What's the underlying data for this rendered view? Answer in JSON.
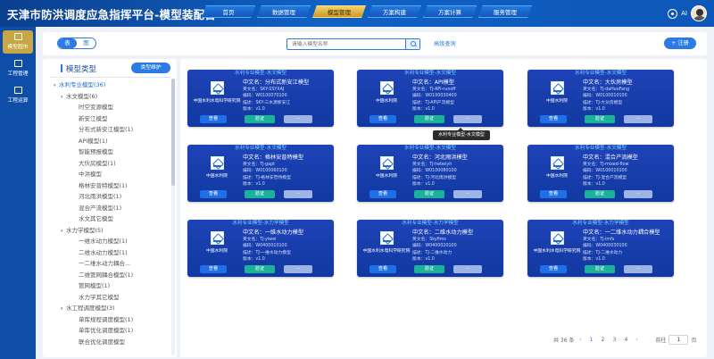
{
  "header": {
    "title": "天津市防洪调度应急指挥平台-模型装配台",
    "nav": [
      "首页",
      "数据管理",
      "模型管理",
      "方案构建",
      "方案计算",
      "服务管理"
    ],
    "active_nav": 2,
    "user_label": "AI"
  },
  "rail": {
    "items": [
      {
        "label": "模型超市",
        "icon": "model-market-icon",
        "active": true
      },
      {
        "label": "工程管理",
        "icon": "project-icon",
        "active": false
      },
      {
        "label": "工程运算",
        "icon": "compute-icon",
        "active": false
      }
    ]
  },
  "toolbar": {
    "toggle": [
      "表",
      "图"
    ],
    "search_placeholder": "请输入模型名称",
    "advanced": "高级查询",
    "register": "+ 注册"
  },
  "tree": {
    "title": "模型类型",
    "maint_button": "类型维护",
    "nodes": [
      {
        "label": "水利专业模型(36)",
        "level": 0,
        "caret": "▾"
      },
      {
        "label": "水文模型(6)",
        "level": 1,
        "caret": "▾"
      },
      {
        "label": "时空变源模型",
        "level": 2,
        "caret": ""
      },
      {
        "label": "新安江模型",
        "level": 2,
        "caret": ""
      },
      {
        "label": "分布式新安江模型(1)",
        "level": 2,
        "caret": ""
      },
      {
        "label": "API模型(1)",
        "level": 2,
        "caret": ""
      },
      {
        "label": "智能预报模型",
        "level": 2,
        "caret": ""
      },
      {
        "label": "大伙房模型(1)",
        "level": 2,
        "caret": ""
      },
      {
        "label": "中洪模型",
        "level": 2,
        "caret": ""
      },
      {
        "label": "格林安普特模型(1)",
        "level": 2,
        "caret": ""
      },
      {
        "label": "河北雨洪模型(1)",
        "level": 2,
        "caret": ""
      },
      {
        "label": "混合产流模型(1)",
        "level": 2,
        "caret": ""
      },
      {
        "label": "水文其它模型",
        "level": 2,
        "caret": ""
      },
      {
        "label": "水力学模型(5)",
        "level": 1,
        "caret": "▾"
      },
      {
        "label": "一维水动力模型(1)",
        "level": 2,
        "caret": ""
      },
      {
        "label": "二维水动力模型(1)",
        "level": 2,
        "caret": ""
      },
      {
        "label": "一二维水动力耦合...",
        "level": 2,
        "caret": ""
      },
      {
        "label": "二维管网耦合模型(1)",
        "level": 2,
        "caret": ""
      },
      {
        "label": "管网模型(1)",
        "level": 2,
        "caret": ""
      },
      {
        "label": "水力学其它模型",
        "level": 2,
        "caret": ""
      },
      {
        "label": "水工程调度模型(3)",
        "level": 1,
        "caret": "▾"
      },
      {
        "label": "单库规程调度模型(1)",
        "level": 2,
        "caret": ""
      },
      {
        "label": "单库优化调度模型(1)",
        "level": 2,
        "caret": ""
      },
      {
        "label": "联合优化调度模型",
        "level": 2,
        "caret": ""
      }
    ]
  },
  "cards": [
    {
      "category": "水利专业模型-水文模型",
      "org": "中国水利水电科学研究院",
      "cn": "中文名：分布式新安江模型",
      "en": "英文名：SKY-SSYXAJ",
      "code": "编码：W0100070100",
      "desc": "描述：SKY-三水源新安江",
      "ver": "版本：v1.0"
    },
    {
      "category": "水利专业模型-水文模型",
      "org": "中国水利院",
      "cn": "中文名：API模型",
      "en": "英文名：TJ-API-runoff",
      "code": "编码：W0100030400",
      "desc": "描述：TJ-API产流模型",
      "ver": "版本：v1.0"
    },
    {
      "category": "水利专业模型-水文模型",
      "org": "中国水利院",
      "cn": "中文名：大伙房模型",
      "en": "英文名：TJ-daHuoFang",
      "code": "编码：W0100010100",
      "desc": "描述：TJ-大伙房模型",
      "ver": "版本：v1.0"
    },
    {
      "category": "水利专业模型-水文模型",
      "org": "中国水利院",
      "cn": "中文名：格林安普特模型",
      "en": "英文名：TJ-gapt",
      "code": "编码：W0100060100",
      "desc": "描述：TJ-格林安普特模型",
      "ver": "版本：v1.0"
    },
    {
      "category": "水利专业模型-水文模型",
      "org": "中国水利院",
      "cn": "中文名：河北雨洪模型",
      "en": "英文名：TJ-hebeiyh",
      "code": "编码：W0100080100",
      "desc": "描述：TJ-河北雨洪模型",
      "ver": "版本：v1.0"
    },
    {
      "category": "水利专业模型-水文模型",
      "org": "中国水利院",
      "cn": "中文名：混合产流模型",
      "en": "英文名：TJ-mixed-flow",
      "code": "编码：W0100010100",
      "desc": "描述：TJ-混合产流模型",
      "ver": "版本：v1.0"
    },
    {
      "category": "水利专业模型-水力学模型",
      "org": "中国水利院",
      "cn": "中文名：一维水动力模型",
      "en": "英文名：TJ-yiwei",
      "code": "编码：W0400010100",
      "desc": "描述：TJ-一维水动力模型",
      "ver": "版本：v1.0"
    },
    {
      "category": "水利专业模型-水力学模型",
      "org": "中国水利水电科学研究院",
      "cn": "中文名：二维水动力模型",
      "en": "英文名：Skyfims",
      "code": "编码：W0400020100",
      "desc": "描述：TJ-二维水动力",
      "ver": "版本：v1.0"
    },
    {
      "category": "水利专业模型-水力学模型",
      "org": "中国水利水电科学研究院",
      "cn": "中文名：一二维水动力耦合模型",
      "en": "英文名：TJ-imfs",
      "code": "编码：W0400030100",
      "desc": "描述：TJ-二维水动力",
      "ver": "版本：v1.0"
    }
  ],
  "card_buttons": {
    "view": "查看",
    "verify": "验证",
    "more": "···"
  },
  "tooltip": "水利专业模型-水文模型",
  "pager": {
    "total": "共 36 条",
    "prev": "‹",
    "pages": [
      "1",
      "2",
      "3",
      "4"
    ],
    "current": 0,
    "next": "›",
    "goto": "前往",
    "page_input": "1",
    "page_unit": "页"
  }
}
